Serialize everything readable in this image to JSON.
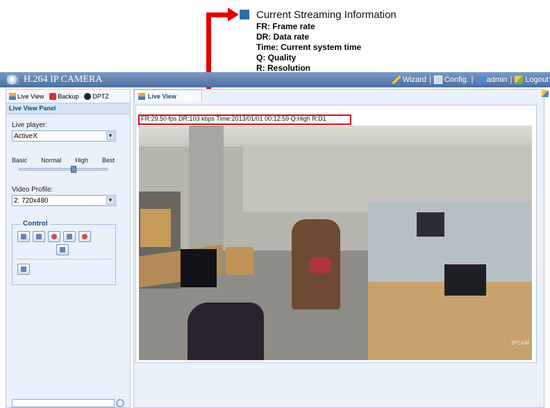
{
  "annotation": {
    "title": "Current Streaming Information",
    "items": [
      "FR: Frame rate",
      "DR: Data rate",
      "Time: Current system time",
      "Q: Quality",
      "R: Resolution"
    ],
    "accent_color": "#2e6da4",
    "arrow_color": "#e60000"
  },
  "header": {
    "title": "H.264 IP CAMERA",
    "menu": {
      "wizard": "Wizard",
      "config": "Config.",
      "user": "admin",
      "logout": "Logout"
    }
  },
  "left_panel": {
    "tabs": [
      "Live View",
      "Backup",
      "DPTZ"
    ],
    "panel_title": "Live View Panel",
    "live_player_label": "Live player:",
    "live_player_value": "ActiveX",
    "quality_levels": [
      "Basic",
      "Normal",
      "High",
      "Best"
    ],
    "quality_selected": "High",
    "video_profile_label": "Video Profile:",
    "video_profile_value": "2: 720x480",
    "control_title": "Control"
  },
  "main": {
    "tab_label": "Live View",
    "info_text": "FR:29.50 fps  DR:103 kbps Time:2013/01/01 00:12:59 Q:High R:D1",
    "watermark": "IPCAM"
  }
}
